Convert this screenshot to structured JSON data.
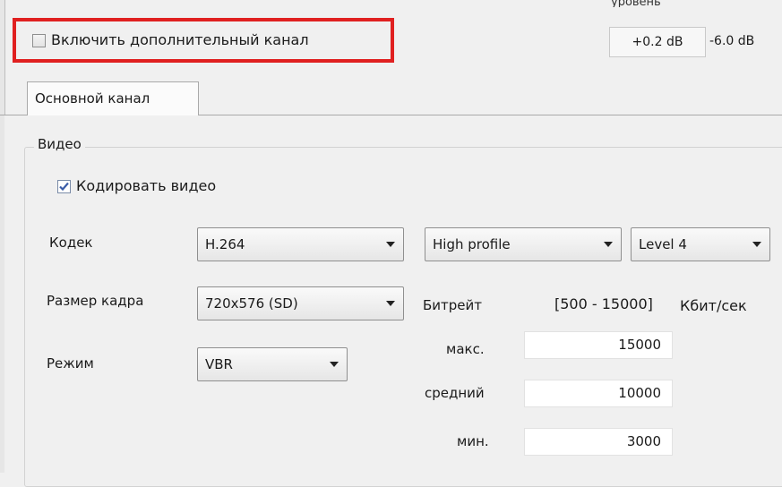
{
  "top": {
    "cut_label": "уровень",
    "extra_channel_label": "Включить дополнительный канал",
    "level_value": "+0.2 dB",
    "level_value2": "-6.0 dB"
  },
  "tabs": [
    {
      "label": "Основной канал",
      "selected": true
    }
  ],
  "video_group": {
    "title": "Видео",
    "encode_label": "Кодировать видео",
    "encode_checked": true,
    "codec": {
      "label": "Кодек",
      "value": "H.264",
      "profile": "High profile",
      "level": "Level 4"
    },
    "frame_size": {
      "label": "Размер кадра",
      "value": "720x576 (SD)"
    },
    "bitrate": {
      "label": "Битрейт",
      "range": "[500 - 15000]",
      "unit": "Кбит/сек",
      "max_label": "макс.",
      "max_value": "15000",
      "avg_label": "средний",
      "avg_value": "10000",
      "min_label": "мин.",
      "min_value": "3000"
    },
    "mode": {
      "label": "Режим",
      "value": "VBR"
    }
  },
  "colors": {
    "highlight": "#e02020",
    "checkbox_check": "#3b5da8"
  }
}
